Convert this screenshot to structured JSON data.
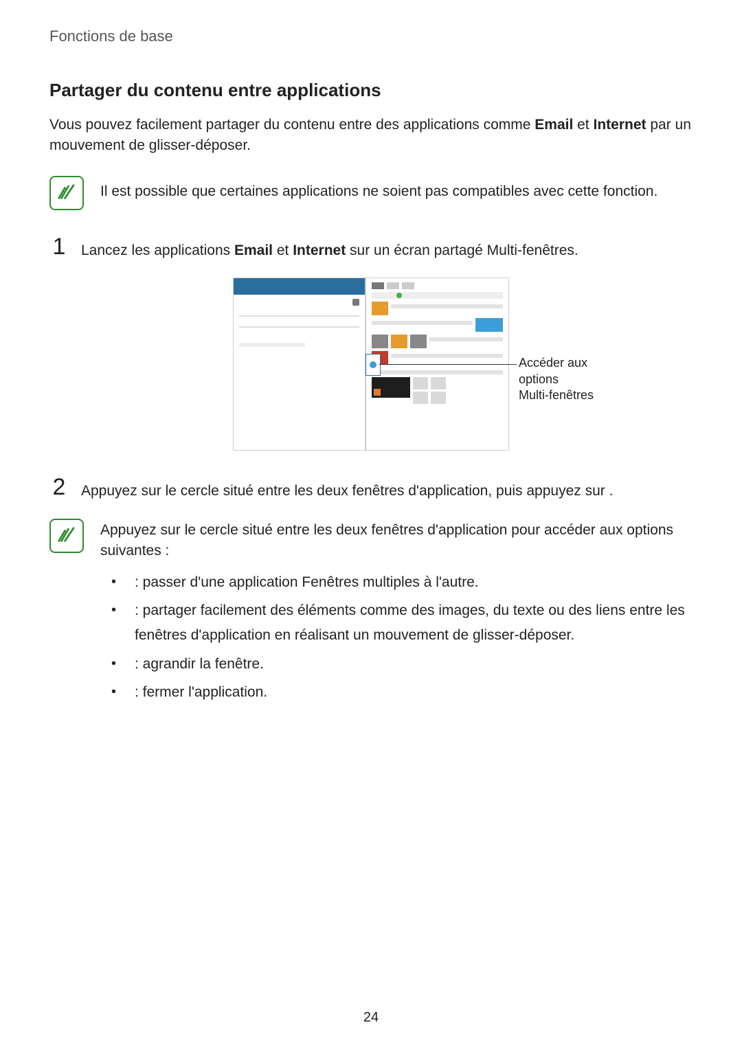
{
  "breadcrumb": "Fonctions de base",
  "section_title": "Partager du contenu entre applications",
  "intro_pre": "Vous pouvez facilement partager du contenu entre des applications comme ",
  "intro_b1": "Email",
  "intro_mid": " et ",
  "intro_b2": "Internet",
  "intro_post": " par un mouvement de glisser-déposer.",
  "note1": "Il est possible que certaines applications ne soient pas compatibles avec cette fonction.",
  "step1_num": "1",
  "step1_pre": "Lancez les applications ",
  "step1_b1": "Email",
  "step1_mid": " et ",
  "step1_b2": "Internet",
  "step1_post": " sur un écran partagé Multi-fenêtres.",
  "callout_line1": "Accéder aux options",
  "callout_line2": "Multi-fenêtres",
  "step2_num": "2",
  "step2_text": "Appuyez sur le cercle situé entre les deux fenêtres d'application, puis appuyez sur      .",
  "note2_intro": "Appuyez sur le cercle situé entre les deux fenêtres d'application pour accéder aux options suivantes :",
  "opt1": " : passer d'une application Fenêtres multiples à l'autre.",
  "opt2": " : partager facilement des éléments comme des images, du texte ou des liens entre les fenêtres d'application en réalisant un mouvement de glisser-déposer.",
  "opt3": " : agrandir la fenêtre.",
  "opt4": " : fermer l'application.",
  "page_number": "24"
}
